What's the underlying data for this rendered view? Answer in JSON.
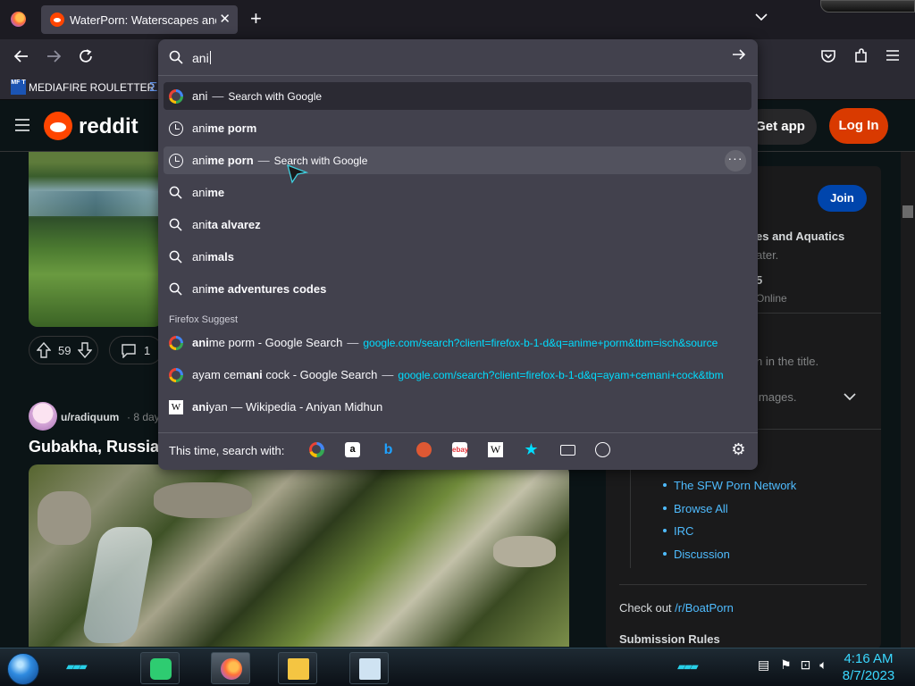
{
  "browser": {
    "tab_title": "WaterPorn: Waterscapes and Aquatics",
    "new_tab_symbol": "+",
    "close_symbol": "✕",
    "list_tabs_symbol": "⌵"
  },
  "bookmarks": {
    "items": [
      {
        "icon_text": "MF T",
        "label": "MEDIAFIRE ROULETTER"
      }
    ]
  },
  "urlbar": {
    "typed_text": "ani",
    "results": [
      {
        "icon": "google-icon",
        "prefix": "ani",
        "bold": "",
        "separator": "—",
        "action": "Search with Google",
        "url": "",
        "style": "first"
      },
      {
        "icon": "history-clock-icon",
        "prefix": "ani",
        "bold": "me porm",
        "separator": "",
        "action": "",
        "url": "",
        "style": ""
      },
      {
        "icon": "history-clock-icon",
        "prefix": "ani",
        "bold": "me porn",
        "separator": "—",
        "action": "Search with Google",
        "url": "",
        "style": "selected"
      },
      {
        "icon": "search-icon",
        "prefix": "ani",
        "bold": "me",
        "separator": "",
        "action": "",
        "url": "",
        "style": ""
      },
      {
        "icon": "search-icon",
        "prefix": "ani",
        "bold": "ta alvarez",
        "separator": "",
        "action": "",
        "url": "",
        "style": ""
      },
      {
        "icon": "search-icon",
        "prefix": "ani",
        "bold": "mals",
        "separator": "",
        "action": "",
        "url": "",
        "style": ""
      },
      {
        "icon": "search-icon",
        "prefix": "ani",
        "bold": "me adventures codes",
        "separator": "",
        "action": "",
        "url": "",
        "style": ""
      }
    ],
    "suggest_heading": "Firefox Suggest",
    "suggest_results": [
      {
        "icon": "google-icon",
        "pre": "",
        "hi": "ani",
        "post": "me porm - Google Search",
        "url": "google.com/search?client=firefox-b-1-d&q=anime+porm&tbm=isch&source"
      },
      {
        "icon": "google-icon",
        "pre": "ayam cem",
        "hi": "ani",
        "post": " cock - Google Search",
        "url": "google.com/search?client=firefox-b-1-d&q=ayam+cemani+cock&tbm"
      },
      {
        "icon": "wikipedia-icon",
        "pre": "",
        "hi": "ani",
        "post": "yan — Wikipedia - Aniyan Midhun",
        "url": ""
      }
    ],
    "oneoff_label": "This time, search with:",
    "oneoff_engines": [
      "Google",
      "Amazon.com",
      "Bing",
      "DuckDuckGo",
      "eBay",
      "Wikipedia (en)",
      "Bookmarks",
      "Tabs",
      "History"
    ]
  },
  "reddit": {
    "wordmark": "reddit",
    "get_app": "Get app",
    "log_in": "Log In",
    "join": "Join",
    "post1": {
      "votes": "59",
      "comments": "1"
    },
    "post2": {
      "user": "u/radiquum",
      "age": "· 8 day",
      "title": "Gubakha, Russia ["
    },
    "sidebar": {
      "community_fragment": "es and Aquatics",
      "desc_fragment": "ater.",
      "members_fragment": "5",
      "online_label": "Online",
      "rule_fragment": "n in the title.",
      "images_fragment": "images.",
      "links": [
        "The SFW Porn Network",
        "Browse All",
        "IRC",
        "Discussion"
      ],
      "checkout_text": "Check out ",
      "checkout_link": "/r/BoatPorn",
      "submission_rules": "Submission Rules"
    }
  },
  "taskbar": {
    "time": "4:16 AM",
    "date": "8/7/2023"
  },
  "colors": {
    "popup_bg": "#42414d",
    "suggest_url": "#00ddff",
    "reddit_orange": "#ff4500",
    "login_bg": "#d93a00",
    "join_bg": "#0045ac",
    "clock_text": "#3ad8ff"
  }
}
